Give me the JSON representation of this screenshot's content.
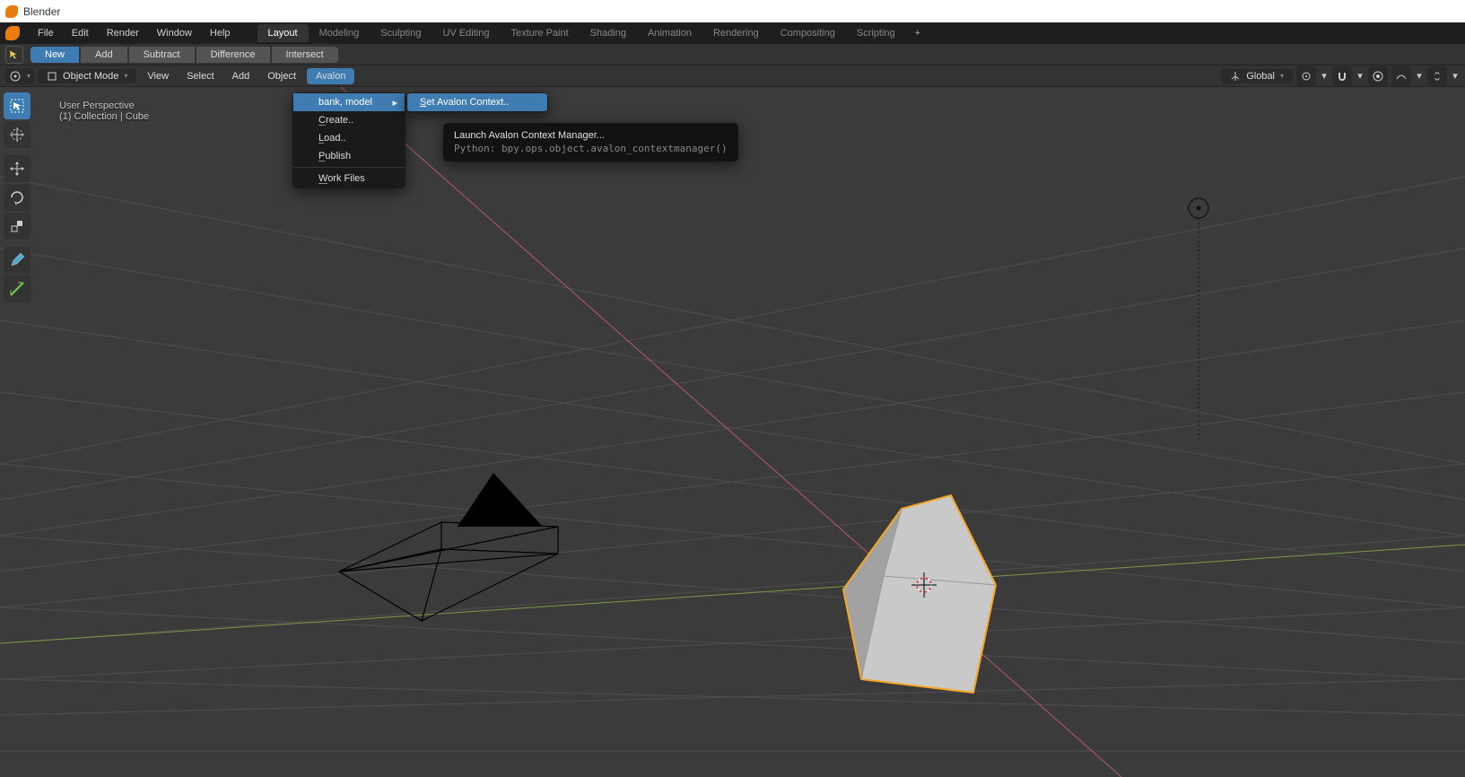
{
  "app_title": "Blender",
  "topmenu": {
    "items": [
      "File",
      "Edit",
      "Render",
      "Window",
      "Help"
    ]
  },
  "workspace_tabs": [
    "Layout",
    "Modeling",
    "Sculpting",
    "UV Editing",
    "Texture Paint",
    "Shading",
    "Animation",
    "Rendering",
    "Compositing",
    "Scripting"
  ],
  "workspace_active_index": 0,
  "toolbar_row": {
    "new": "New",
    "add": "Add",
    "subtract": "Subtract",
    "difference": "Difference",
    "intersect": "Intersect"
  },
  "viewport_header": {
    "mode": "Object Mode",
    "menus": [
      "View",
      "Select",
      "Add",
      "Object",
      "Avalon"
    ],
    "active_menu_index": 4,
    "orientation": "Global"
  },
  "overlay": {
    "line1": "User Perspective",
    "line2": "(1) Collection | Cube"
  },
  "avalon_menu": {
    "context_label": "bank, model",
    "items": [
      "Create..",
      "Load..",
      "Publish",
      "Work Files"
    ],
    "submenu_label": "Set Avalon Context.."
  },
  "tooltip": {
    "title": "Launch Avalon Context Manager...",
    "python": "Python: bpy.ops.object.avalon_contextmanager()"
  }
}
